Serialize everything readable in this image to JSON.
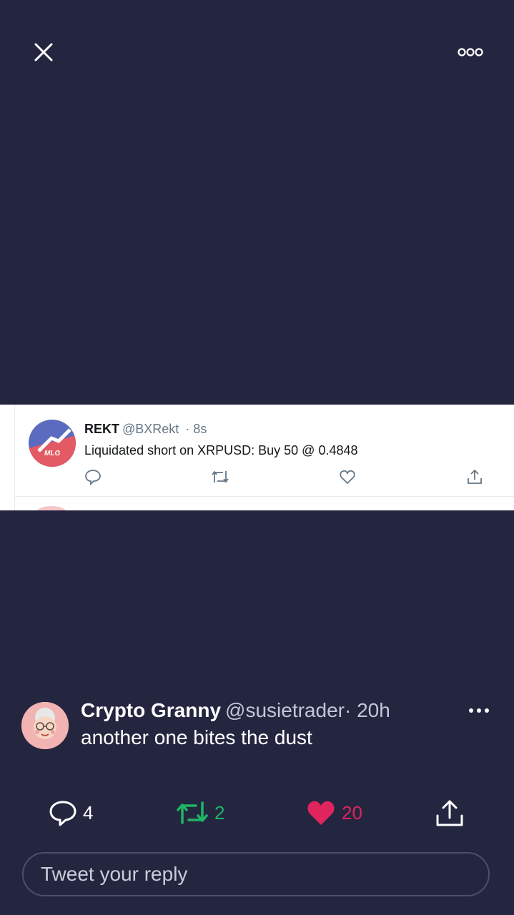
{
  "media": {
    "tweet": {
      "name": "REKT",
      "handle": "@BXRekt",
      "time": "· 8s",
      "text": "Liquidated short on XRPUSD: Buy 50 @ 0.4848",
      "avatar_label": "MLG"
    }
  },
  "tweet": {
    "name": "Crypto Granny",
    "handle": "@susietrader",
    "time": "· 20h",
    "text": "another one bites the dust",
    "reply_count": "4",
    "retweet_count": "2",
    "like_count": "20"
  },
  "reply": {
    "placeholder": "Tweet your reply"
  },
  "colors": {
    "background": "#242640",
    "retweet": "#1fb566",
    "like": "#e0245e"
  },
  "icons": {
    "close": "close-icon",
    "more": "more-horizontal-icon",
    "reply": "reply-bubble-icon",
    "retweet": "retweet-icon",
    "like": "heart-icon",
    "share": "share-icon"
  }
}
